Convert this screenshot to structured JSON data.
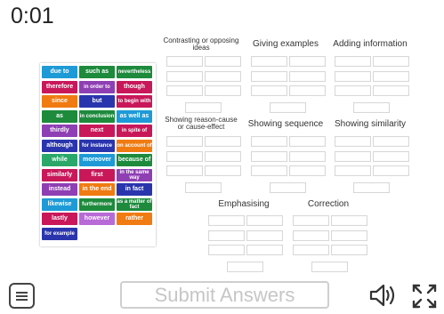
{
  "timer": "0:01",
  "submit_label": "Submit Answers",
  "tiles": [
    {
      "text": "due to",
      "color": "#1e9ad6"
    },
    {
      "text": "such as",
      "color": "#1d8a3c"
    },
    {
      "text": "nevertheless",
      "color": "#1d8a3c"
    },
    {
      "text": "therefore",
      "color": "#c8185a"
    },
    {
      "text": "in order to",
      "color": "#8e3fb3"
    },
    {
      "text": "though",
      "color": "#c8185a"
    },
    {
      "text": "since",
      "color": "#f07b12"
    },
    {
      "text": "but",
      "color": "#2a35ad"
    },
    {
      "text": "to begin with",
      "color": "#c8185a"
    },
    {
      "text": "as",
      "color": "#1d8a3c"
    },
    {
      "text": "in conclusion",
      "color": "#1d8a3c"
    },
    {
      "text": "as well as",
      "color": "#1e9ad6"
    },
    {
      "text": "thirdly",
      "color": "#8e3fb3"
    },
    {
      "text": "next",
      "color": "#c8185a"
    },
    {
      "text": "in spite of",
      "color": "#c8185a"
    },
    {
      "text": "although",
      "color": "#2a35ad"
    },
    {
      "text": "for instance",
      "color": "#2a35ad"
    },
    {
      "text": "on account of",
      "color": "#f07b12"
    },
    {
      "text": "while",
      "color": "#2aa86a"
    },
    {
      "text": "moreover",
      "color": "#1e9ad6"
    },
    {
      "text": "because of",
      "color": "#1d8a3c"
    },
    {
      "text": "similarly",
      "color": "#c8185a"
    },
    {
      "text": "first",
      "color": "#c8185a"
    },
    {
      "text": "in the same way",
      "color": "#8e3fb3"
    },
    {
      "text": "instead",
      "color": "#8e3fb3"
    },
    {
      "text": "in the end",
      "color": "#f07b12"
    },
    {
      "text": "in fact",
      "color": "#2a35ad"
    },
    {
      "text": "likewise",
      "color": "#1e9ad6"
    },
    {
      "text": "furthermore",
      "color": "#1d8a3c"
    },
    {
      "text": "as a matter of fact",
      "color": "#1d8a3c"
    },
    {
      "text": "lastly",
      "color": "#c8185a"
    },
    {
      "text": "however",
      "color": "#b86ad6"
    },
    {
      "text": "rather",
      "color": "#f07b12"
    },
    {
      "text": "for example",
      "color": "#2a35ad"
    }
  ],
  "categories": [
    {
      "title": "Contrasting or opposing ideas"
    },
    {
      "title": "Giving examples"
    },
    {
      "title": "Adding information"
    },
    {
      "title": "Showing reason-cause or cause-effect"
    },
    {
      "title": "Showing sequence"
    },
    {
      "title": "Showing similarity"
    },
    {
      "title": "Emphasising"
    },
    {
      "title": "Correction"
    }
  ]
}
